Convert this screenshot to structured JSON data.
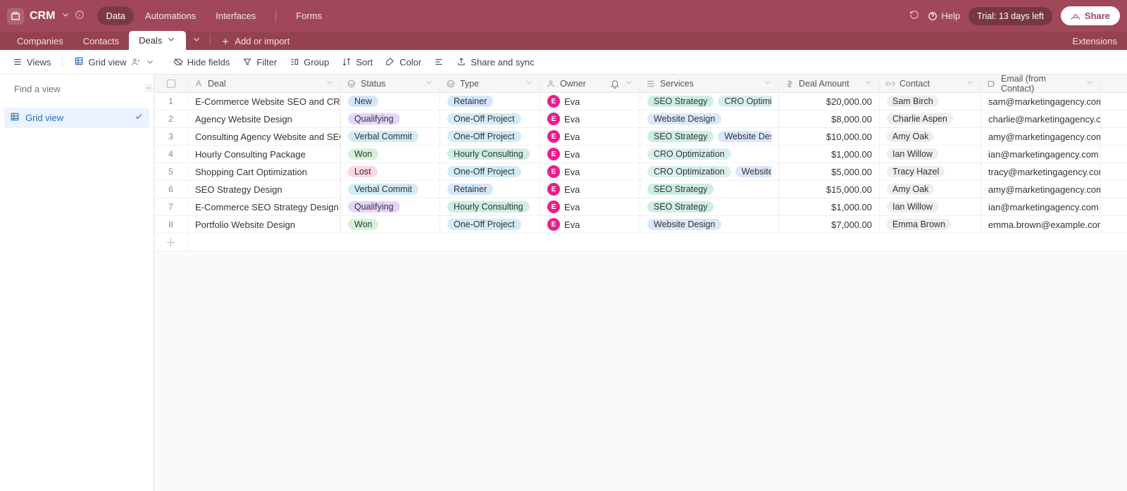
{
  "topbar": {
    "base_name": "CRM",
    "nav": {
      "data": "Data",
      "automations": "Automations",
      "interfaces": "Interfaces",
      "forms": "Forms"
    },
    "help": "Help",
    "trial": "Trial: 13 days left",
    "share": "Share"
  },
  "tablebar": {
    "tables": [
      "Companies",
      "Contacts",
      "Deals"
    ],
    "active_index": 2,
    "add_import": "Add or import",
    "extensions": "Extensions"
  },
  "toolbar": {
    "views": "Views",
    "grid_view": "Grid view",
    "hide_fields": "Hide fields",
    "filter": "Filter",
    "group": "Group",
    "sort": "Sort",
    "color": "Color",
    "share_sync": "Share and sync"
  },
  "sidebar": {
    "find_placeholder": "Find a view",
    "view_name": "Grid view"
  },
  "columns": {
    "deal": "Deal",
    "status": "Status",
    "type": "Type",
    "owner": "Owner",
    "services": "Services",
    "amount": "Deal Amount",
    "contact": "Contact",
    "email": "Email (from Contact)"
  },
  "pill_colors": {
    "status": {
      "New": "#d4e6fb",
      "Qualifying": "#e6d4fb",
      "Verbal Commit": "#d2ecf6",
      "Won": "#d4f2d9",
      "Lost": "#fbd7e1"
    },
    "type": {
      "Retainer": "#d4e6fb",
      "One-Off Project": "#d2ecf6",
      "Hourly Consulting": "#cdeee4"
    },
    "services": {
      "SEO Strategy": "#cdeee4",
      "CRO Optimization": "#d7f0ee",
      "Website Design": "#dbe7fb"
    }
  },
  "rows": [
    {
      "deal": "E-Commerce Website SEO and CRO",
      "status": "New",
      "type": "Retainer",
      "owner": {
        "initial": "E",
        "name": "Eva"
      },
      "services": [
        "SEO Strategy",
        "CRO Optimization"
      ],
      "amount": "$20,000.00",
      "contact": "Sam Birch",
      "email": "sam@marketingagency.com"
    },
    {
      "deal": "Agency Website Design",
      "status": "Qualifying",
      "type": "One-Off Project",
      "owner": {
        "initial": "E",
        "name": "Eva"
      },
      "services": [
        "Website Design"
      ],
      "amount": "$8,000.00",
      "contact": "Charlie Aspen",
      "email": "charlie@marketingagency.com"
    },
    {
      "deal": "Consulting Agency Website and SEO",
      "status": "Verbal Commit",
      "type": "One-Off Project",
      "owner": {
        "initial": "E",
        "name": "Eva"
      },
      "services": [
        "SEO Strategy",
        "Website Design"
      ],
      "amount": "$10,000.00",
      "contact": "Amy Oak",
      "email": "amy@marketingagency.com"
    },
    {
      "deal": "Hourly Consulting Package",
      "status": "Won",
      "type": "Hourly Consulting",
      "owner": {
        "initial": "E",
        "name": "Eva"
      },
      "services": [
        "CRO Optimization"
      ],
      "amount": "$1,000.00",
      "contact": "Ian Willow",
      "email": "ian@marketingagency.com"
    },
    {
      "deal": "Shopping Cart Optimization",
      "status": "Lost",
      "type": "One-Off Project",
      "owner": {
        "initial": "E",
        "name": "Eva"
      },
      "services": [
        "CRO Optimization",
        "Website Design"
      ],
      "amount": "$5,000.00",
      "contact": "Tracy Hazel",
      "email": "tracy@marketingagency.com"
    },
    {
      "deal": "SEO Strategy Design",
      "status": "Verbal Commit",
      "type": "Retainer",
      "owner": {
        "initial": "E",
        "name": "Eva"
      },
      "services": [
        "SEO Strategy"
      ],
      "amount": "$15,000.00",
      "contact": "Amy Oak",
      "email": "amy@marketingagency.com"
    },
    {
      "deal": "E-Commerce SEO Strategy Design",
      "status": "Qualifying",
      "type": "Hourly Consulting",
      "owner": {
        "initial": "E",
        "name": "Eva"
      },
      "services": [
        "SEO Strategy"
      ],
      "amount": "$1,000.00",
      "contact": "Ian Willow",
      "email": "ian@marketingagency.com"
    },
    {
      "deal": "Portfolio Website Design",
      "status": "Won",
      "type": "One-Off Project",
      "owner": {
        "initial": "E",
        "name": "Eva"
      },
      "services": [
        "Website Design"
      ],
      "amount": "$7,000.00",
      "contact": "Emma Brown",
      "email": "emma.brown@example.com"
    }
  ]
}
